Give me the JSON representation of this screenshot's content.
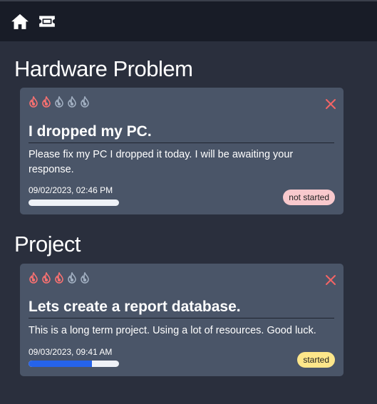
{
  "nav": {
    "home_icon": "home-icon",
    "tickets_icon": "ticket-icon"
  },
  "categories": [
    {
      "title": "Hardware Problem",
      "tickets": [
        {
          "priority_total": 5,
          "priority_level": 2,
          "title": "I dropped my PC.",
          "description": "Please fix my PC I dropped it today. I will be awaiting your response.",
          "date": "09/02/2023, 02:46 PM",
          "progress": 0,
          "status": "not started",
          "status_color": "#f8c9cd"
        }
      ]
    },
    {
      "title": "Project",
      "tickets": [
        {
          "priority_total": 5,
          "priority_level": 3,
          "title": "Lets create a report database.",
          "description": "This is a long term project. Using a lot of resources. Good luck.",
          "date": "09/03/2023, 09:41 AM",
          "progress": 0.7,
          "status": "started",
          "status_color": "#fde68a"
        }
      ]
    }
  ],
  "colors": {
    "flame_active": "#f87171",
    "flame_inactive": "#a0aec0",
    "close": "#f56565",
    "progress_fill": "#2563eb"
  }
}
